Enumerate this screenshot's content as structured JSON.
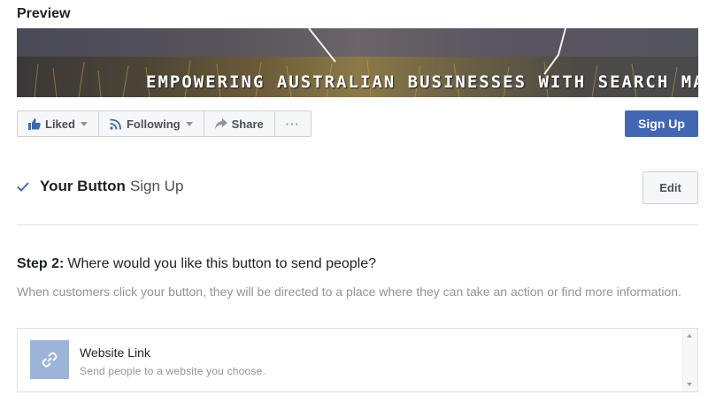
{
  "preview": {
    "title": "Preview"
  },
  "cover": {
    "text": "EMPOWERING AUSTRALIAN BUSINESSES WITH SEARCH MARKETING"
  },
  "action_bar": {
    "liked": "Liked",
    "following": "Following",
    "share": "Share",
    "more": "···",
    "signup": "Sign Up"
  },
  "your_button": {
    "title": "Your Button",
    "value": "Sign Up",
    "edit": "Edit"
  },
  "step": {
    "label": "Step 2:",
    "question": "Where would you like this button to send people?",
    "description": "When customers click your button, they will be directed to a place where they can take an action or find more information."
  },
  "option": {
    "title": "Website Link",
    "subtitle": "Send people to a website you choose."
  },
  "colors": {
    "primary": "#4267b2",
    "link_icon_bg": "#9cb4d8",
    "muted_text": "#90949c"
  }
}
